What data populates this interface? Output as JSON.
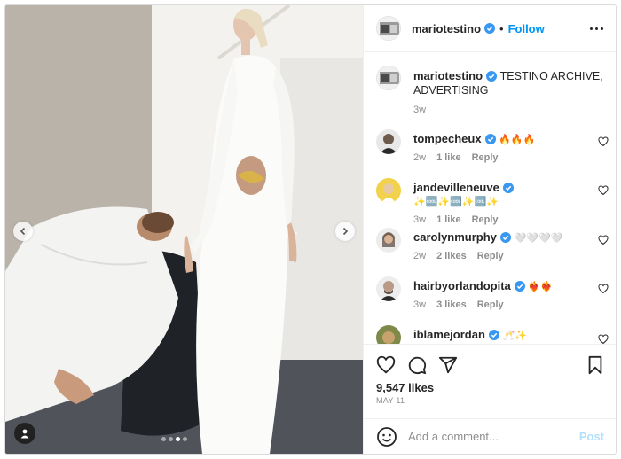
{
  "post": {
    "username": "mariotestino",
    "follow_label": "Follow",
    "separator": "•",
    "caption_text": "TESTINO ARCHIVE, ADVERTISING",
    "caption_time": "3w",
    "likes": "9,547 likes",
    "date": "MAY 11",
    "add_comment_placeholder": "Add a comment...",
    "post_label": "Post",
    "carousel": {
      "total_slides": 4,
      "active_slide": 3
    }
  },
  "comments": [
    {
      "username": "tompecheux",
      "text": "🔥🔥🔥",
      "time": "2w",
      "likes": "1 like",
      "reply": "Reply"
    },
    {
      "username": "jandevilleneuve",
      "text": "✨🆒✨🆒✨🆒✨",
      "time": "3w",
      "likes": "1 like",
      "reply": "Reply"
    },
    {
      "username": "carolynmurphy",
      "text": "🤍🤍🤍🤍",
      "time": "2w",
      "likes": "2 likes",
      "reply": "Reply"
    },
    {
      "username": "hairbyorlandopita",
      "text": "❤️‍🔥❤️‍🔥",
      "time": "3w",
      "likes": "3 likes",
      "reply": "Reply"
    },
    {
      "username": "iblamejordan",
      "text": "🥂✨",
      "time": "",
      "likes": "",
      "reply": ""
    }
  ],
  "colors": {
    "accent": "#0095f6",
    "verified": "#3897f0",
    "muted": "#8e8e8e",
    "post_disabled": "#b2dffc"
  },
  "icons": [
    "verified-badge-icon",
    "more-options-icon",
    "chevron-left-icon",
    "chevron-right-icon",
    "user-tag-icon",
    "heart-icon",
    "comment-icon",
    "share-icon",
    "bookmark-icon",
    "emoji-icon"
  ]
}
